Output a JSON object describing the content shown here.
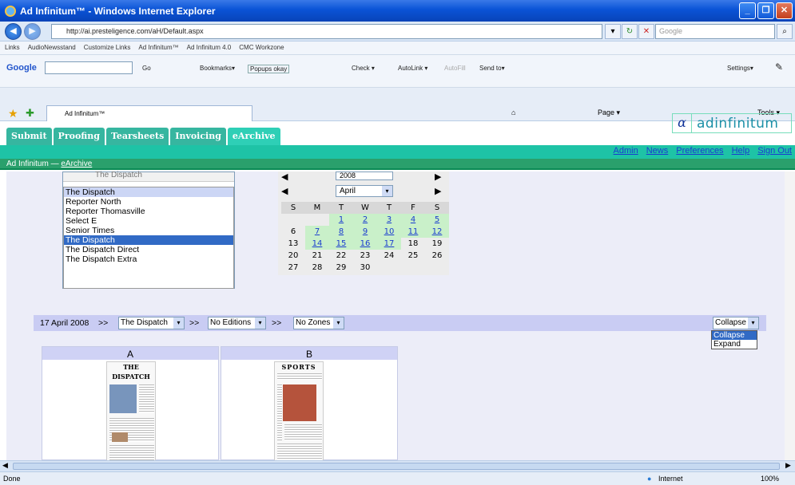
{
  "window": {
    "title": "Ad Infinitum™ - Windows Internet Explorer"
  },
  "browser": {
    "address": "http://ai.presteligence.com/aH/Default.aspx",
    "search_placeholder": "Google",
    "links_label": "Links",
    "links": [
      "AudioNewsstand",
      "Customize Links",
      "Ad Infinitum™",
      "Ad Infinitum 4.0",
      "CMC Workzone"
    ],
    "google_label": "Google",
    "google_tools": [
      "Go",
      "Bookmarks▾",
      "Popups okay",
      "Check ▾",
      "AutoLink ▾",
      "AutoFill",
      "Send to▾"
    ],
    "settings_label": "Settings▾",
    "tab_title": "Ad Infinitum™",
    "page_menu": "Page ▾",
    "tools_menu": "Tools ▾",
    "status_left": "Done",
    "status_zone": "Internet",
    "zoom": "100%"
  },
  "app": {
    "logo_mark": "α",
    "logo_text": "adinfinitum",
    "tabs": [
      "Submit",
      "Proofing",
      "Tearsheets",
      "Invoicing",
      "eArchive"
    ],
    "active_tab": "eArchive",
    "top_links": [
      "Admin",
      "News",
      "Preferences",
      "Help",
      "Sign Out"
    ],
    "breadcrumb_prefix": "Ad Infinitum —",
    "breadcrumb_link": "eArchive"
  },
  "publication_list": {
    "dropdown_value": "The Dispatch",
    "header": "The Dispatch",
    "items": [
      "Reporter North",
      "Reporter Thomasville",
      "Select E",
      "Senior Times",
      "The Dispatch",
      "The Dispatch Direct",
      "The Dispatch Extra"
    ],
    "selected": "The Dispatch"
  },
  "calendar": {
    "year": "2008",
    "month": "April",
    "days_of_week": [
      "S",
      "M",
      "T",
      "W",
      "T",
      "F",
      "S"
    ],
    "weeks": [
      [
        "",
        "",
        "1",
        "2",
        "3",
        "4",
        "5"
      ],
      [
        "6",
        "7",
        "8",
        "9",
        "10",
        "11",
        "12"
      ],
      [
        "13",
        "14",
        "15",
        "16",
        "17",
        "18",
        "19"
      ],
      [
        "20",
        "21",
        "22",
        "23",
        "24",
        "25",
        "26"
      ],
      [
        "27",
        "28",
        "29",
        "30",
        "",
        "",
        ""
      ]
    ],
    "linked_days": [
      "1",
      "2",
      "3",
      "4",
      "5",
      "7",
      "8",
      "9",
      "10",
      "11",
      "12",
      "14",
      "15",
      "16",
      "17"
    ]
  },
  "filter": {
    "date": "17 April 2008",
    "sep": ">>",
    "publication": "The Dispatch",
    "edition": "No Editions",
    "zone": "No Zones",
    "view": "Collapse",
    "view_options": [
      "Collapse",
      "Expand"
    ]
  },
  "pages": [
    {
      "label": "A",
      "masthead": "THE DISPATCH"
    },
    {
      "label": "B",
      "masthead": "SPORTS"
    }
  ]
}
